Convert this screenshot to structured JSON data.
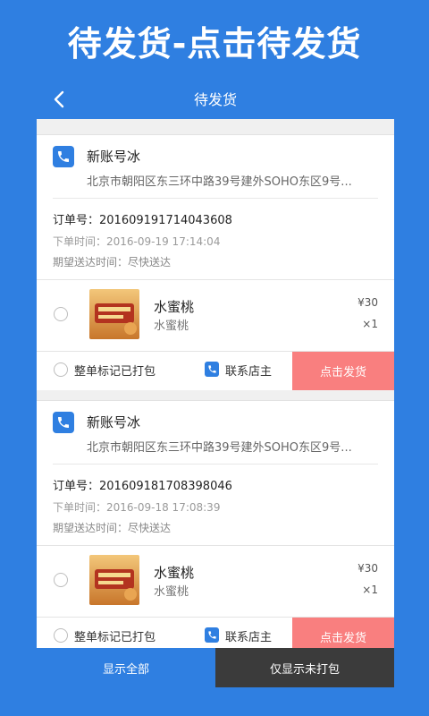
{
  "banner": {
    "title": "待发货-点击待发货"
  },
  "appbar": {
    "title": "待发货",
    "back_icon": "chevron-left-icon"
  },
  "orders": [
    {
      "name": "新账号冰",
      "address": "北京市朝阳区东三环中路39号建外SOHO东区9号...",
      "order_no": "订单号：201609191714043608",
      "order_time": "下单时间：2016-09-19 17:14:04",
      "expect_time": "期望送达时间：尽快送达",
      "item": {
        "name": "水蜜桃",
        "desc": "水蜜桃",
        "price": "¥30",
        "qty": "×1"
      },
      "pack_label": "整单标记已打包",
      "contact_label": "联系店主",
      "ship_label": "点击发货"
    },
    {
      "name": "新账号冰",
      "address": "北京市朝阳区东三环中路39号建外SOHO东区9号...",
      "order_no": "订单号：201609181708398046",
      "order_time": "下单时间：2016-09-18 17:08:39",
      "expect_time": "期望送达时间：尽快送达",
      "item": {
        "name": "水蜜桃",
        "desc": "水蜜桃",
        "price": "¥30",
        "qty": "×1"
      },
      "pack_label": "整单标记已打包",
      "contact_label": "联系店主",
      "ship_label": "点击发货"
    }
  ],
  "tabs": {
    "all": "显示全部",
    "unpacked": "仅显示未打包"
  },
  "colors": {
    "primary": "#2f7fe1",
    "ship": "#f97f7f",
    "dark_tab": "#3b3b3b"
  }
}
